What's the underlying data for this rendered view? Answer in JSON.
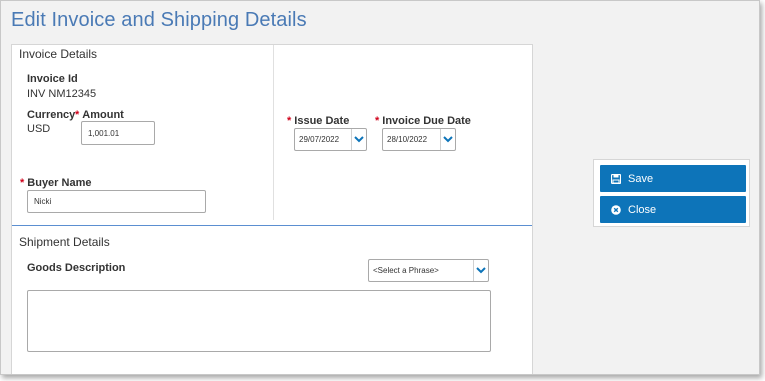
{
  "page": {
    "title": "Edit Invoice and Shipping Details"
  },
  "invoice": {
    "section_title": "Invoice Details",
    "invoice_id_label": "Invoice Id",
    "invoice_id_value": "INV NM12345",
    "currency_label": "Currency",
    "currency_value": "USD",
    "amount_label": "Amount",
    "amount_value": "1,001.01",
    "issue_date_label": "Issue Date",
    "issue_date_value": "29/07/2022",
    "due_date_label": "Invoice Due Date",
    "due_date_value": "28/10/2022",
    "buyer_name_label": "Buyer Name",
    "buyer_name_value": "Nicki",
    "required_marker": "*"
  },
  "shipment": {
    "section_title": "Shipment Details",
    "goods_description_label": "Goods Description",
    "phrase_select_value": "<Select a Phrase>",
    "goods_description_value": ""
  },
  "actions": {
    "save_label": "Save",
    "close_label": "Close",
    "save_icon": "floppy-disk-icon",
    "close_icon": "close-circle-icon"
  },
  "colors": {
    "title": "#4a7ab5",
    "button": "#0d74b9",
    "required": "#d0021b",
    "divider": "#5b8fd1"
  }
}
